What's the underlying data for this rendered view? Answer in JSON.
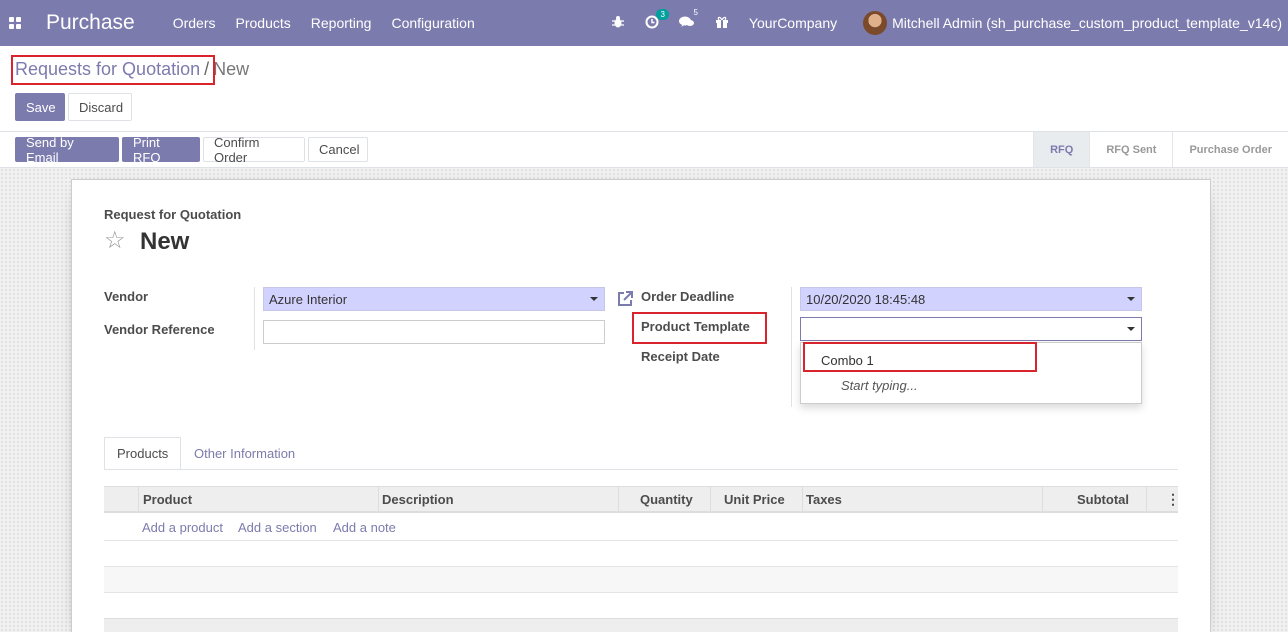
{
  "navbar": {
    "app_name": "Purchase",
    "menu": [
      "Orders",
      "Products",
      "Reporting",
      "Configuration"
    ],
    "activity_count": "3",
    "messages_count": "5",
    "company": "YourCompany",
    "user": "Mitchell Admin (sh_purchase_custom_product_template_v14c)",
    "color": "#7c7bad"
  },
  "breadcrumb": {
    "parent": "Requests for Quotation",
    "separator": "/",
    "current": "New"
  },
  "actions": {
    "save": "Save",
    "discard": "Discard"
  },
  "header_buttons": {
    "send_email": "Send by Email",
    "print_rfq": "Print RFQ",
    "confirm": "Confirm Order",
    "cancel": "Cancel"
  },
  "statusbar": [
    "RFQ",
    "RFQ Sent",
    "Purchase Order"
  ],
  "form": {
    "doc_kind": "Request for Quotation",
    "title": "New",
    "vendor_label": "Vendor",
    "vendor_value": "Azure Interior",
    "vendor_ref_label": "Vendor Reference",
    "vendor_ref_value": "",
    "order_deadline_label": "Order Deadline",
    "order_deadline_value": "10/20/2020 18:45:48",
    "product_template_label": "Product Template",
    "product_template_value": "",
    "receipt_date_label": "Receipt Date"
  },
  "dropdown": {
    "option": "Combo 1",
    "hint": "Start typing..."
  },
  "tabs": [
    "Products",
    "Other Information"
  ],
  "table": {
    "headers": [
      "Product",
      "Description",
      "Quantity",
      "Unit Price",
      "Taxes",
      "Subtotal"
    ],
    "add_product": "Add a product",
    "add_section": "Add a section",
    "add_note": "Add a note"
  },
  "icons": {
    "apps": "apps-grid-icon",
    "bug": "bug-icon",
    "activity": "clock-icon",
    "messages": "chat-icon",
    "gift": "gift-icon",
    "star": "star-icon",
    "external": "external-link-icon",
    "caret": "caret-down-icon",
    "options": "kebab-icon"
  }
}
